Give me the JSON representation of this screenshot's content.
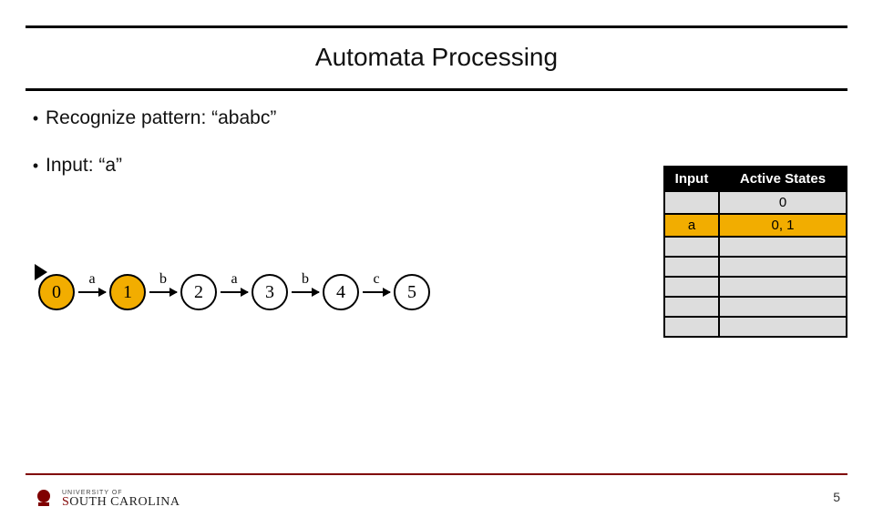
{
  "title": "Automata Processing",
  "bullets": {
    "pattern": "Recognize pattern:  “ababc”",
    "input": "Input:  “a”"
  },
  "automaton": {
    "states": [
      {
        "label": "0",
        "active": true
      },
      {
        "label": "1",
        "active": true
      },
      {
        "label": "2",
        "active": false
      },
      {
        "label": "3",
        "active": false
      },
      {
        "label": "4",
        "active": false
      },
      {
        "label": "5",
        "active": false
      }
    ],
    "edges": [
      "a",
      "b",
      "a",
      "b",
      "c"
    ]
  },
  "trace": {
    "headers": {
      "input": "Input",
      "states": "Active States"
    },
    "rows": [
      {
        "input": "",
        "states": "0",
        "highlight": false
      },
      {
        "input": "a",
        "states": "0, 1",
        "highlight": true
      },
      {
        "input": "",
        "states": "",
        "highlight": false
      },
      {
        "input": "",
        "states": "",
        "highlight": false
      },
      {
        "input": "",
        "states": "",
        "highlight": false
      },
      {
        "input": "",
        "states": "",
        "highlight": false
      },
      {
        "input": "",
        "states": "",
        "highlight": false
      }
    ]
  },
  "footer": {
    "logo_top": "UNIVERSITY OF",
    "logo_main_pre": "S",
    "logo_main_post": "OUTH CAROLINA",
    "page": "5"
  }
}
